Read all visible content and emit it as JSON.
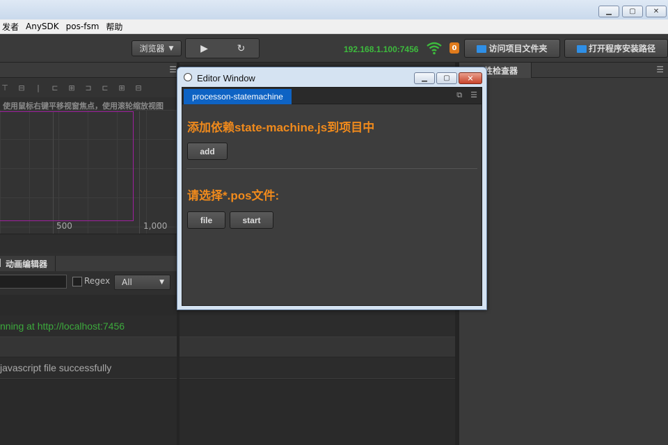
{
  "os_window": {
    "buttons": [
      "minimize",
      "restore",
      "close"
    ],
    "button_glyphs": {
      "minimize": "▁",
      "restore": "▢",
      "close": "✕"
    }
  },
  "menubar": {
    "items": [
      "发者",
      "AnySDK",
      "pos-fsm",
      "帮助"
    ]
  },
  "toolbar": {
    "browser_select_label": "浏览器",
    "play_glyph": "▶",
    "refresh_glyph": "↻",
    "ip_address": "192.168.1.100:7456",
    "notification_count": "0",
    "open_project_folder_label": "访问项目文件夹",
    "open_install_path_label": "打开程序安装路径"
  },
  "scene": {
    "hint": "使用鼠标右键平移视窗焦点，使用滚轮缩放视图",
    "tick_500": "500",
    "tick_1000": "1,000"
  },
  "console": {
    "tab_label": "动画编辑器",
    "regex_label": "Regex",
    "level_value": "All",
    "logs": [
      {
        "text": "nning at http://localhost:7456",
        "level": "success"
      },
      {
        "text": "",
        "level": "info"
      },
      {
        "text": "javascript file successfully",
        "level": "info"
      }
    ]
  },
  "inspector": {
    "tab_label": "性检查器"
  },
  "editor_window": {
    "title": "Editor Window",
    "tab_label": "processon-statemachine",
    "heading_dependency": "添加依赖state-machine.js到项目中",
    "add_button_label": "add",
    "heading_select_file": "请选择*.pos文件:",
    "file_button_label": "file",
    "start_button_label": "start"
  },
  "colors": {
    "accent_orange": "#f08a1c",
    "tab_blue": "#0e63c4",
    "ip_green": "#3dbb3d",
    "log_green": "#3daa3d",
    "badge_orange": "#e07b1c"
  }
}
